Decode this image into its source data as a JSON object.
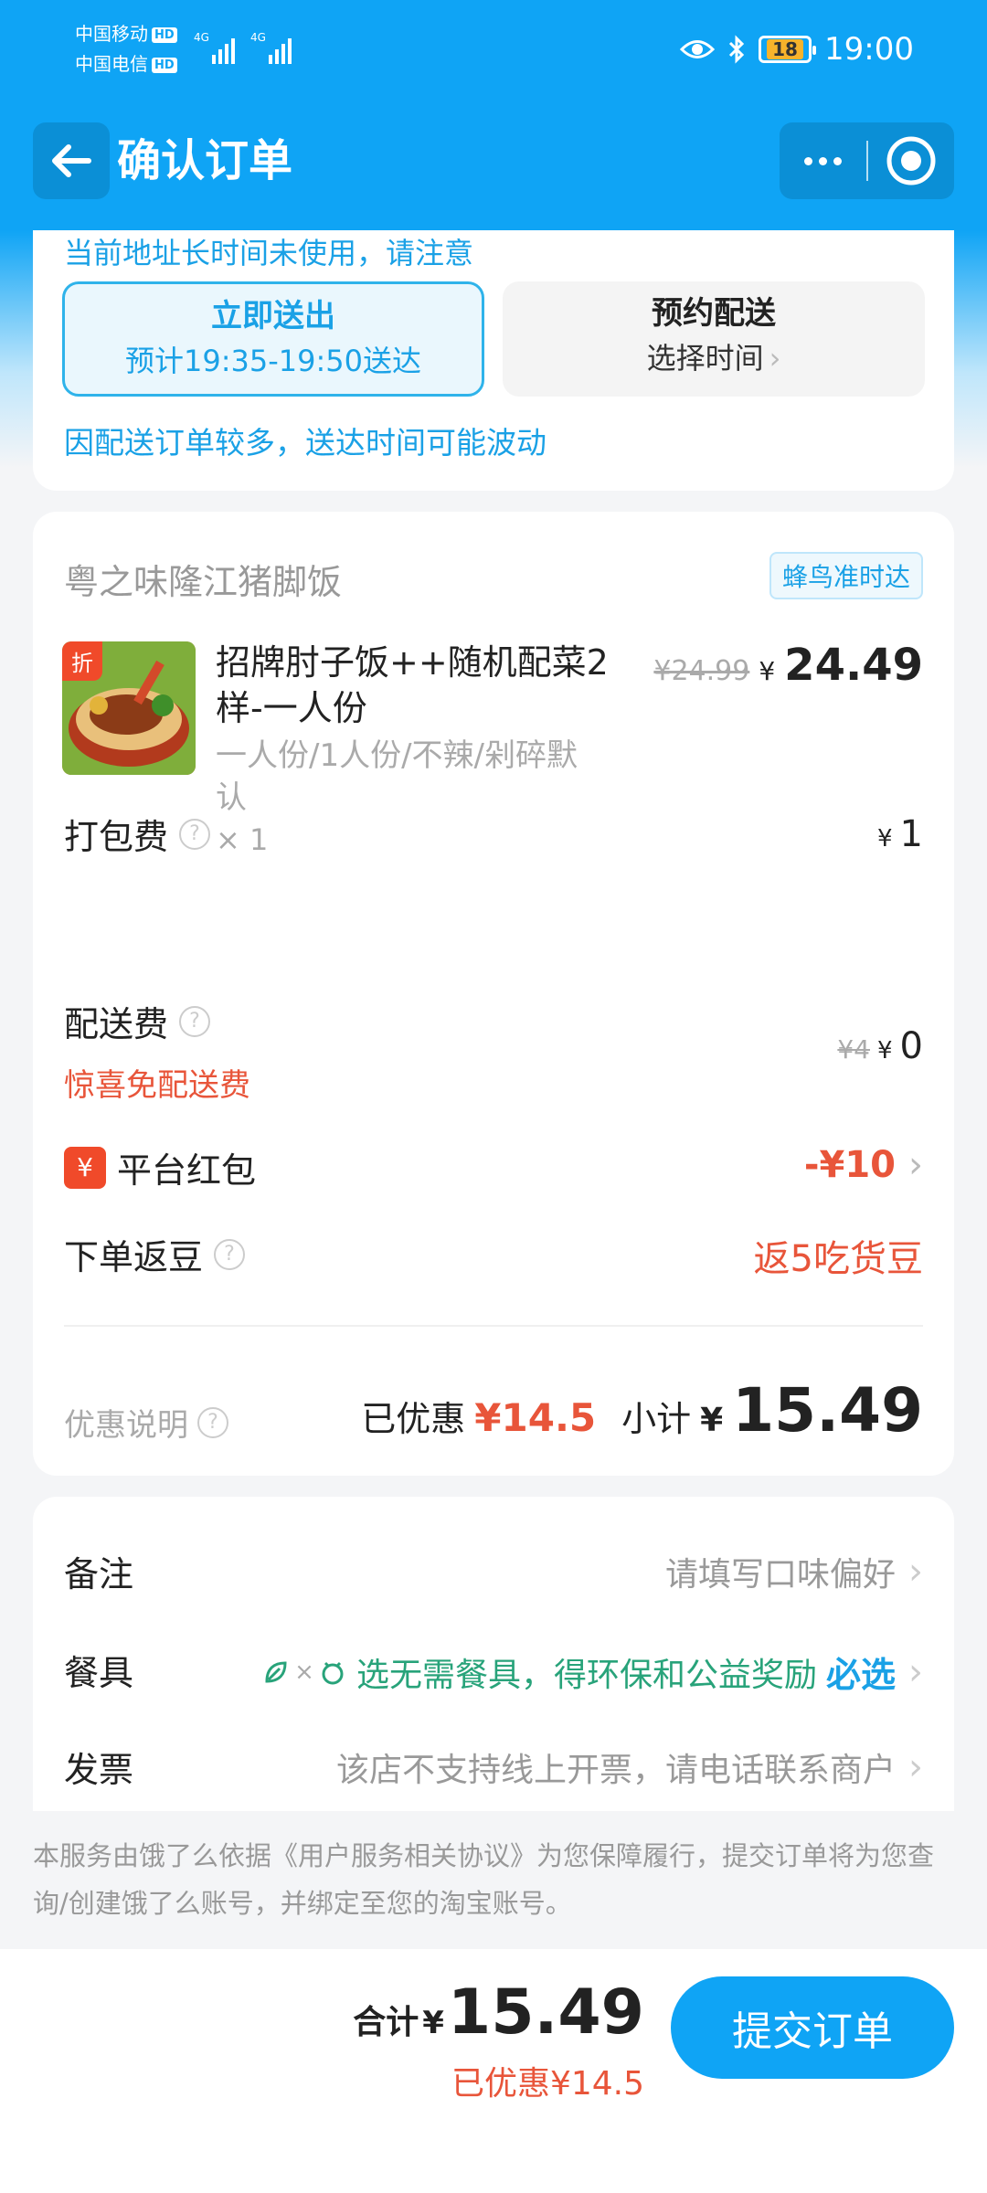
{
  "status_bar": {
    "carrier1": "中国移动",
    "carrier2": "中国电信",
    "hd": "HD",
    "net": "4G",
    "battery": "18",
    "time": "19:00"
  },
  "nav": {
    "title": "确认订单"
  },
  "delivery": {
    "address_warning": "当前地址长时间未使用，请注意",
    "now": {
      "title": "立即送出",
      "subtitle": "预计19:35-19:50送达"
    },
    "scheduled": {
      "title": "预约配送",
      "subtitle": "选择时间"
    },
    "delay_note": "因配送订单较多，送达时间可能波动"
  },
  "order": {
    "shop_name": "粤之味隆江猪脚饭",
    "shop_badge": "蜂鸟准时达",
    "item": {
      "tag": "折",
      "name": "招牌肘子饭++随机配菜2样-一人份",
      "spec": "一人份/1人份/不辣/剁碎默认",
      "qty": "× 1",
      "original_price": "¥24.99",
      "yen": "¥",
      "price": "24.49"
    },
    "packing": {
      "label": "打包费",
      "yen": "¥",
      "value": "1"
    },
    "delivery_fee": {
      "label": "配送费",
      "original": "¥4",
      "yen": "¥",
      "value": "0",
      "promo": "惊喜免配送费"
    },
    "red_packet": {
      "icon": "¥",
      "label": "平台红包",
      "value": "-¥10"
    },
    "beans": {
      "label": "下单返豆",
      "value": "返5吃货豆"
    },
    "discount_note": "优惠说明",
    "summary": {
      "saved_label": "已优惠",
      "saved": "¥14.5",
      "subtotal_label": "小计",
      "yen": "¥",
      "subtotal": "15.49"
    }
  },
  "extras": {
    "remark": {
      "label": "备注",
      "value": "请填写口味偏好"
    },
    "tableware": {
      "label": "餐具",
      "value": "选无需餐具，得环保和公益奖励",
      "must": "必选"
    },
    "invoice": {
      "label": "发票",
      "value": "该店不支持线上开票，请电话联系商户"
    }
  },
  "agreement": "本服务由饿了么依据《用户服务相关协议》为您保障履行，提交订单将为您查询/创建饿了么账号，并绑定至您的淘宝账号。",
  "footer": {
    "total_label": "合计",
    "yen": "¥",
    "total": "15.49",
    "saved": "已优惠¥14.5",
    "submit": "提交订单"
  },
  "colors": {
    "brand": "#0fa4f5",
    "accent_red": "#e8553a",
    "green": "#28a37a"
  }
}
